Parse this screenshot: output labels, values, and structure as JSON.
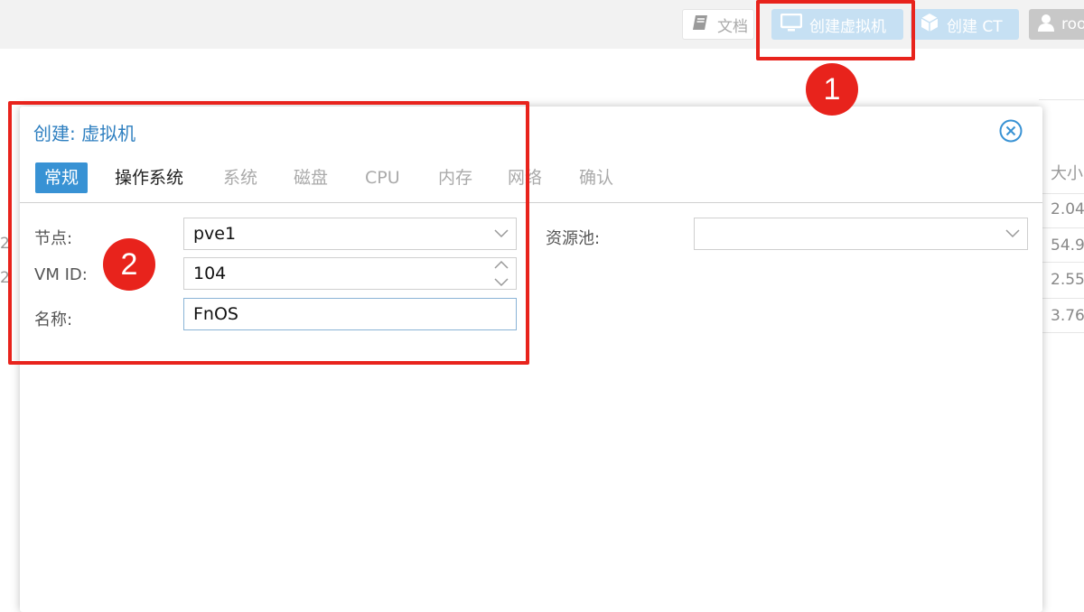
{
  "toolbar": {
    "docs_label": "文档",
    "create_vm_label": "创建虚拟机",
    "create_ct_label": "创建 CT",
    "user_label": "roo"
  },
  "background_grid": {
    "column_header": "大小",
    "cells": [
      "2.04",
      "54.9",
      "2.55",
      "3.76"
    ],
    "left_cells": [
      "2",
      "2"
    ]
  },
  "dialog": {
    "title": "创建: 虚拟机",
    "tabs": [
      {
        "label": "常规",
        "state": "active"
      },
      {
        "label": "操作系统",
        "state": "enabled"
      },
      {
        "label": "系统",
        "state": "disabled"
      },
      {
        "label": "磁盘",
        "state": "disabled"
      },
      {
        "label": "CPU",
        "state": "disabled"
      },
      {
        "label": "内存",
        "state": "disabled"
      },
      {
        "label": "网络",
        "state": "disabled"
      },
      {
        "label": "确认",
        "state": "disabled"
      }
    ],
    "form": {
      "node_label": "节点:",
      "node_value": "pve1",
      "vmid_label": "VM ID:",
      "vmid_value": "104",
      "name_label": "名称:",
      "name_value": "FnOS",
      "pool_label": "资源池:",
      "pool_value": ""
    }
  },
  "annotations": {
    "badge_1": "1",
    "badge_2": "2",
    "color": "#e8231c"
  },
  "colors": {
    "accent": "#3892d4",
    "title": "#2e7fc0",
    "toolbar_button": "#c6e0f3"
  }
}
